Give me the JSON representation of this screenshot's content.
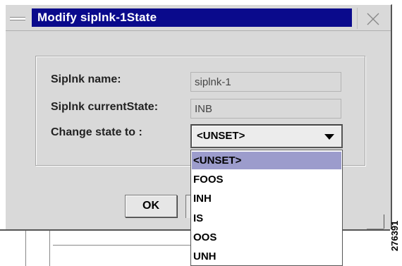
{
  "window": {
    "title": "Modify siplnk-1State",
    "sysmenu_icon": "minus-icon",
    "close_icon": "close-x-icon"
  },
  "form": {
    "name_label": "Siplnk name:",
    "name_value": "siplnk-1",
    "state_label": "Siplnk currentState:",
    "state_value": "INB",
    "change_label": "Change state to :",
    "selected_value": "<UNSET>"
  },
  "dropdown": {
    "options": [
      "<UNSET>",
      "FOOS",
      "INH",
      "IS",
      "OOS",
      "UNH"
    ],
    "selected_index": 0
  },
  "buttons": {
    "ok_label": "OK"
  },
  "figure_id": "276391",
  "colors": {
    "titlebar_bg": "#0a0a8c",
    "selection_bg": "#9c9ccc",
    "dialog_bg": "#d9d9d9"
  }
}
